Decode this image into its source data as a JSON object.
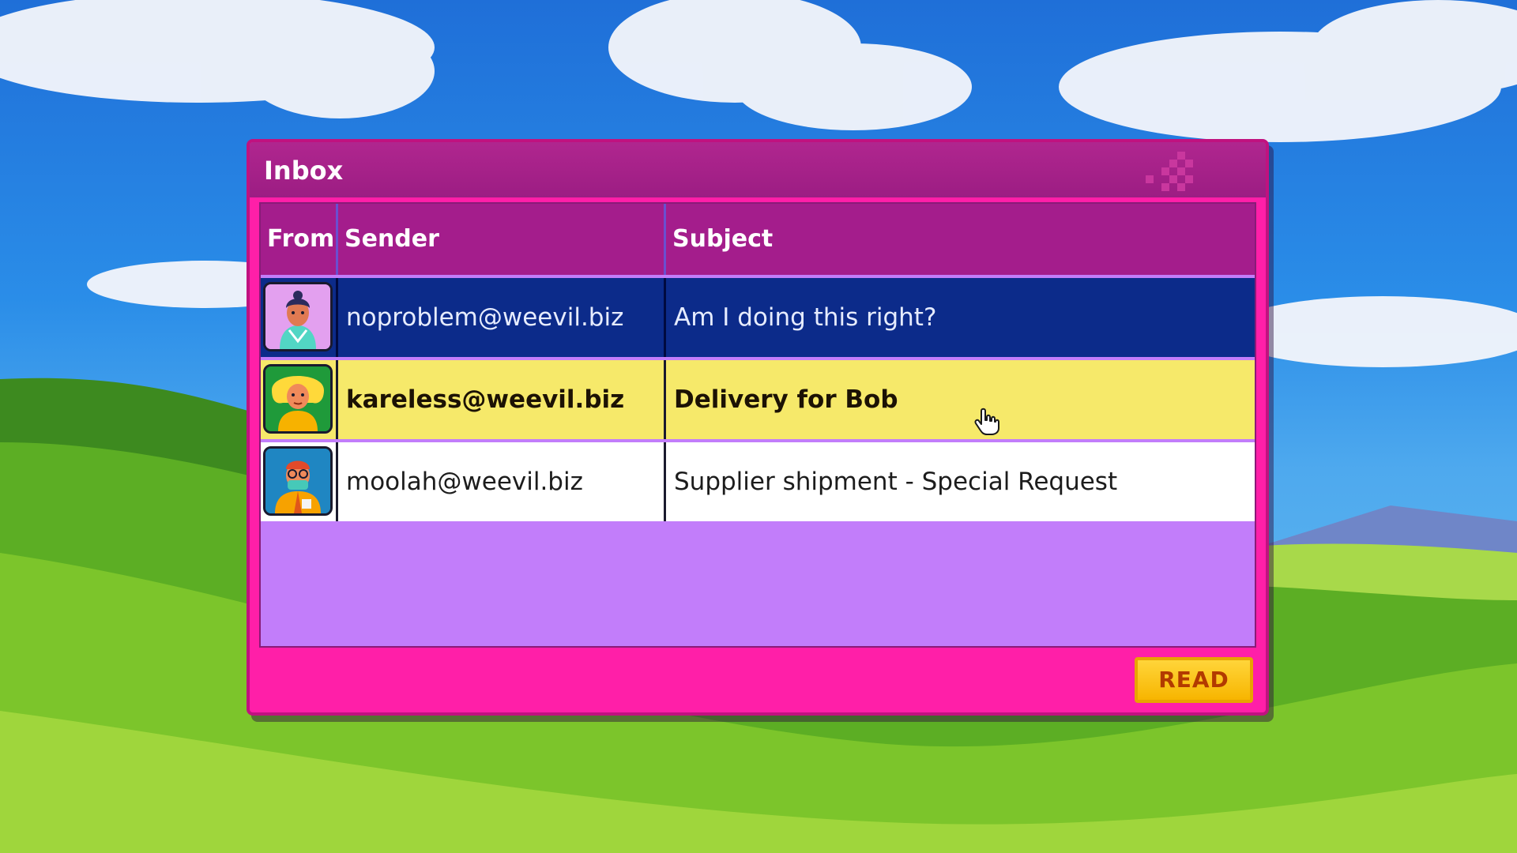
{
  "window": {
    "title": "Inbox"
  },
  "table": {
    "columns": [
      "From",
      "Sender",
      "Subject"
    ],
    "rows": [
      {
        "avatar": "teal-character-avatar",
        "sender": "noproblem@weevil.biz",
        "subject": "Am I doing this right?",
        "state": "selected"
      },
      {
        "avatar": "blonde-character-avatar",
        "sender": "kareless@weevil.biz",
        "subject": "Delivery for Bob",
        "state": "hovered"
      },
      {
        "avatar": "masked-character-avatar",
        "sender": "moolah@weevil.biz",
        "subject": "Supplier shipment - Special Request",
        "state": "normal"
      }
    ]
  },
  "footer": {
    "read_label": "READ"
  },
  "colors": {
    "window": "#ff1fa8",
    "header": "#a41d8c",
    "selected_row": "#0c2b8a",
    "hover_row": "#f6e96a",
    "empty_area": "#c27dfa",
    "button": "#ffc81e"
  },
  "icons": {
    "cursor": "hand-pointer-icon"
  }
}
